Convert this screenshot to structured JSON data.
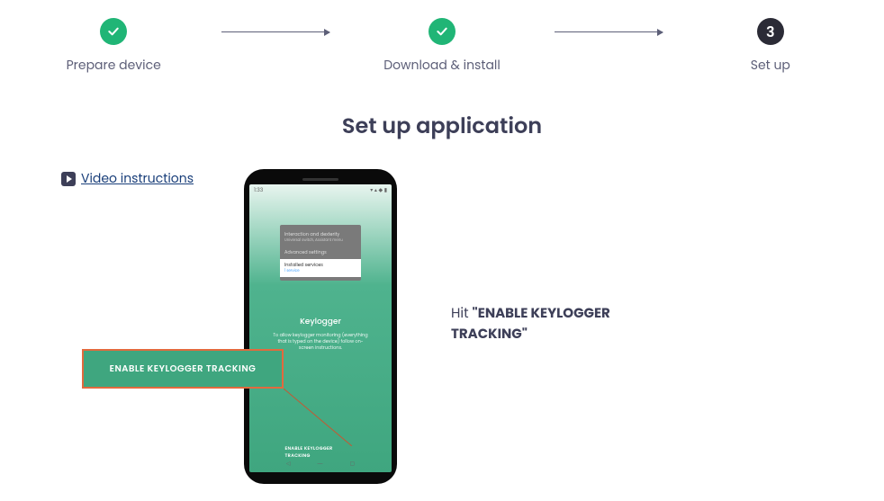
{
  "stepper": {
    "steps": [
      {
        "label": "Prepare device",
        "state": "done"
      },
      {
        "label": "Download & install",
        "state": "done"
      },
      {
        "label": "Set up",
        "state": "current",
        "number": "3"
      }
    ]
  },
  "page_title": "Set up application",
  "video_link_text": " Video instructions",
  "phone": {
    "status_left": "1:33",
    "status_right": "▾ ▴ ◆ ▮",
    "settings_rows": {
      "row1_title": "Interaction and dexterity",
      "row1_sub": "Universal switch, Assistant menu",
      "row2_title": "Advanced settings",
      "row2_sub": "",
      "row3_title": "Installed services",
      "row3_sub": "1 service"
    },
    "keylogger_title": "Keylogger",
    "keylogger_desc": "To allow keylogger monitoring (everything that is typed on the device) follow on-screen instructions.",
    "enable_small": "ENABLE KEYLOGGER TRACKING",
    "nav_back": "◁",
    "nav_home": "―",
    "nav_recent": "▢"
  },
  "callout_button": "ENABLE KEYLOGGER TRACKING",
  "instruction": {
    "prefix": "Hit ",
    "bold": "\"ENABLE KEYLOGGER TRACKING\""
  }
}
